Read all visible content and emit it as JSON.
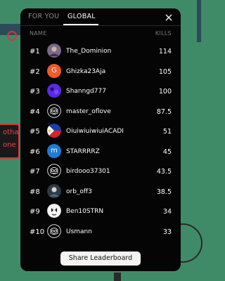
{
  "tabs": {
    "for_you": "FOR YOU",
    "global": "GLOBAL",
    "active": "GLOBAL"
  },
  "columns": {
    "name": "NAME",
    "kills": "KILLS"
  },
  "background": {
    "name_tag_lines": [
      "otha",
      "one"
    ]
  },
  "leaderboard": [
    {
      "rank": "#1",
      "name": "The_Dominion",
      "kills": "114",
      "avatar": "photo-avatar-icon"
    },
    {
      "rank": "#2",
      "name": "Ghizka23Aja",
      "kills": "105",
      "avatar": "letter-avatar-icon",
      "letter": "G",
      "color": "#f15a2a"
    },
    {
      "rank": "#3",
      "name": "Shanngd777",
      "kills": "100",
      "avatar": "purple-avatar-icon",
      "color": "#5a2ae6"
    },
    {
      "rank": "#4",
      "name": "master_oflove",
      "kills": "87.5",
      "avatar": "robot-avatar-icon"
    },
    {
      "rank": "#5",
      "name": "OiuiwiuiwiuiACADI",
      "kills": "51",
      "avatar": "flag-avatar-icon"
    },
    {
      "rank": "#6",
      "name": "STARRRRZ",
      "kills": "45",
      "avatar": "letter-avatar-icon",
      "letter": "m",
      "color": "#1f7bd6"
    },
    {
      "rank": "#7",
      "name": "birdooo37301",
      "kills": "43.5",
      "avatar": "robot-avatar-icon"
    },
    {
      "rank": "#8",
      "name": "orb_off3",
      "kills": "38.5",
      "avatar": "photo-avatar-icon"
    },
    {
      "rank": "#9",
      "name": "Ben10STRN",
      "kills": "34",
      "avatar": "cartoon-avatar-icon"
    },
    {
      "rank": "#10",
      "name": "Usmann",
      "kills": "33",
      "avatar": "robot-avatar-icon"
    }
  ],
  "share_button": "Share Leaderboard",
  "colors": {
    "panel": "#050505",
    "background": "#3f8b68",
    "button": "#f3f3f3"
  }
}
